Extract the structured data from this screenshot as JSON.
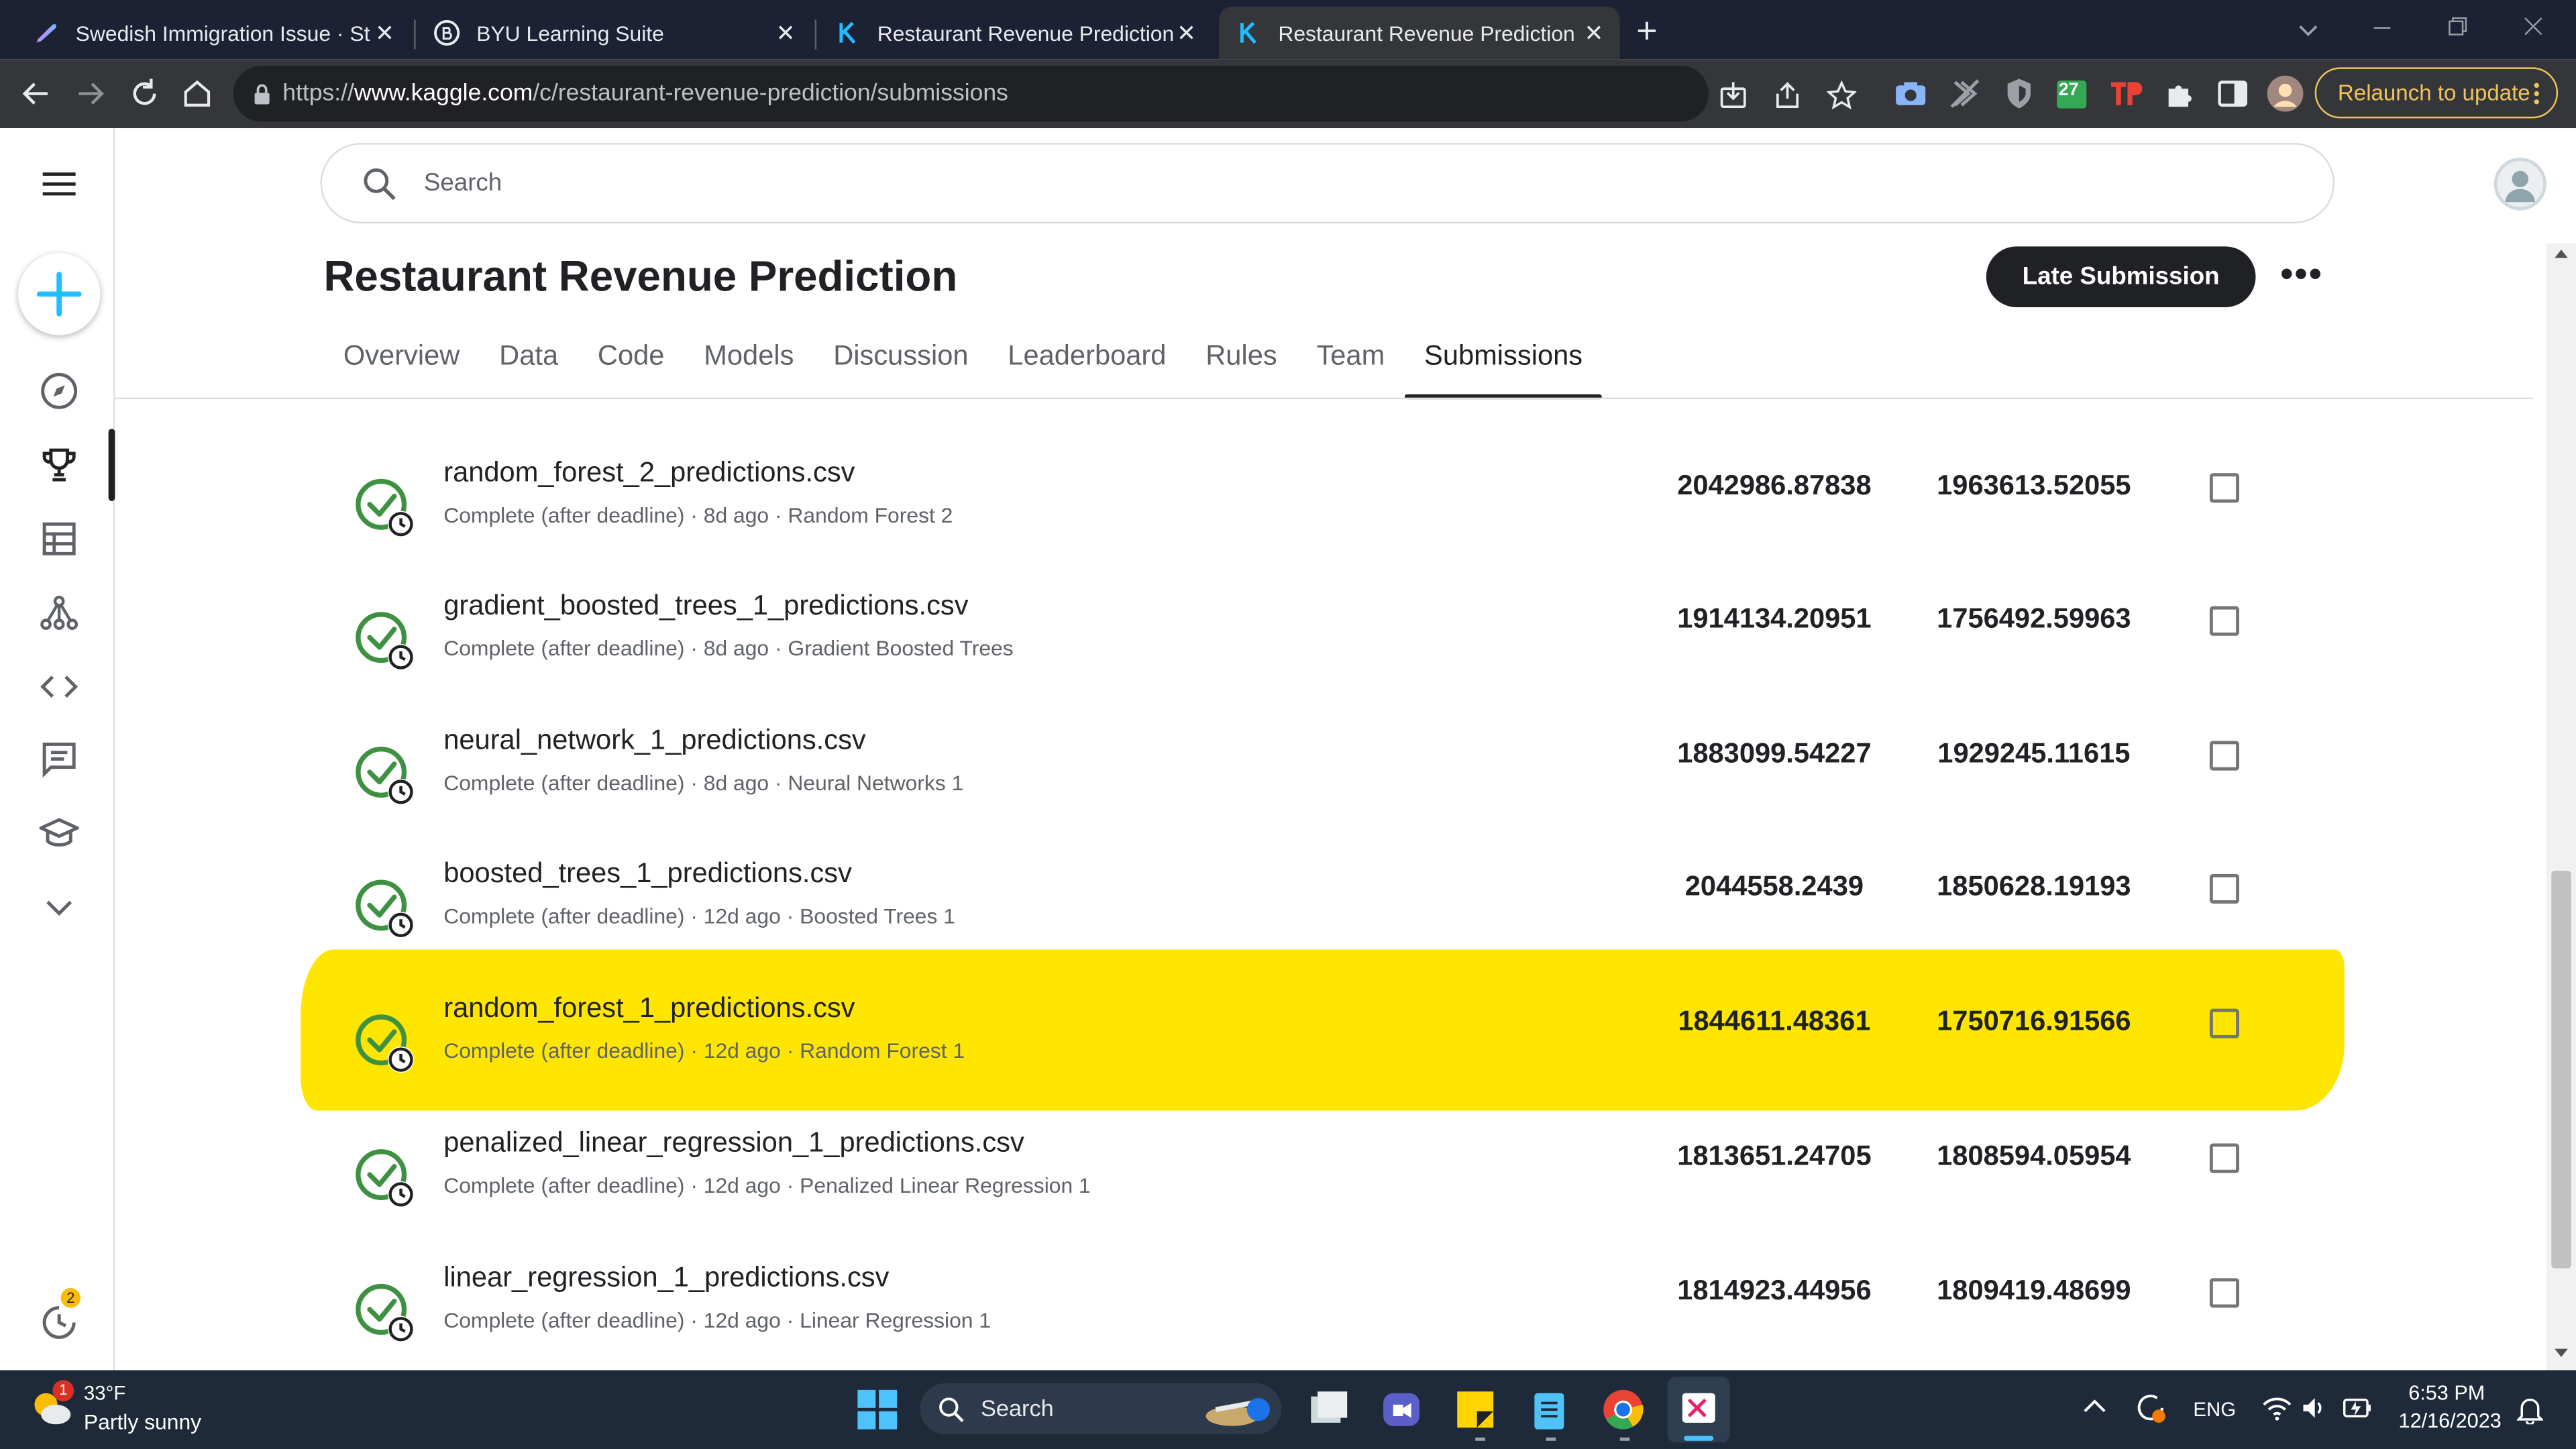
{
  "browser": {
    "tabs": [
      {
        "title": "Swedish Immigration Issue · Stre",
        "close": "✕"
      },
      {
        "title": "BYU Learning Suite",
        "close": "✕"
      },
      {
        "title": "Restaurant Revenue Prediction w",
        "close": "✕"
      },
      {
        "title": "Restaurant Revenue Prediction |",
        "close": "✕"
      }
    ],
    "new_tab": "+",
    "url_prefix": "https://",
    "url_host": "www.kaggle.com",
    "url_path": "/c/restaurant-revenue-prediction/submissions",
    "extension_badge": "27",
    "relaunch_label": "Relaunch to update"
  },
  "kaggle": {
    "search_placeholder": "Search",
    "page_title": "Restaurant Revenue Prediction",
    "late_submission_label": "Late Submission",
    "more_label": "•••",
    "nav_tabs": [
      "Overview",
      "Data",
      "Code",
      "Models",
      "Discussion",
      "Leaderboard",
      "Rules",
      "Team",
      "Submissions"
    ],
    "selected_tab": "Submissions",
    "sidebar_icons": [
      "menu-icon",
      "create-icon",
      "compass-icon",
      "trophy-icon",
      "table-icon",
      "models-icon",
      "code-icon",
      "discussion-icon",
      "learn-icon",
      "expand-icon",
      "history-icon"
    ],
    "notification_badge": "2",
    "submissions": [
      {
        "file": "random_forest_2_predictions.csv",
        "meta": "Complete (after deadline) · 8d ago · Random Forest 2",
        "private": "2042986.87838",
        "public": "1963613.52055"
      },
      {
        "file": "gradient_boosted_trees_1_predictions.csv",
        "meta": "Complete (after deadline) · 8d ago · Gradient Boosted Trees",
        "private": "1914134.20951",
        "public": "1756492.59963"
      },
      {
        "file": "neural_network_1_predictions.csv",
        "meta": "Complete (after deadline) · 8d ago · Neural Networks 1",
        "private": "1883099.54227",
        "public": "1929245.11615"
      },
      {
        "file": "boosted_trees_1_predictions.csv",
        "meta": "Complete (after deadline) · 12d ago · Boosted Trees 1",
        "private": "2044558.2439",
        "public": "1850628.19193"
      },
      {
        "file": "random_forest_1_predictions.csv",
        "meta": "Complete (after deadline) · 12d ago · Random Forest 1",
        "private": "1844611.48361",
        "public": "1750716.91566"
      },
      {
        "file": "penalized_linear_regression_1_predictions.csv",
        "meta": "Complete (after deadline) · 12d ago · Penalized Linear Regression 1",
        "private": "1813651.24705",
        "public": "1808594.05954"
      },
      {
        "file": "linear_regression_1_predictions.csv",
        "meta": "Complete (after deadline) · 12d ago · Linear Regression 1",
        "private": "1814923.44956",
        "public": "1809419.48699"
      }
    ],
    "highlight_color": "#ffe600"
  },
  "taskbar": {
    "weather_temp": "33°F",
    "weather_desc": "Partly sunny",
    "weather_badge": "1",
    "search_label": "Search",
    "lang": "ENG",
    "time": "6:53 PM",
    "date": "12/16/2023"
  }
}
